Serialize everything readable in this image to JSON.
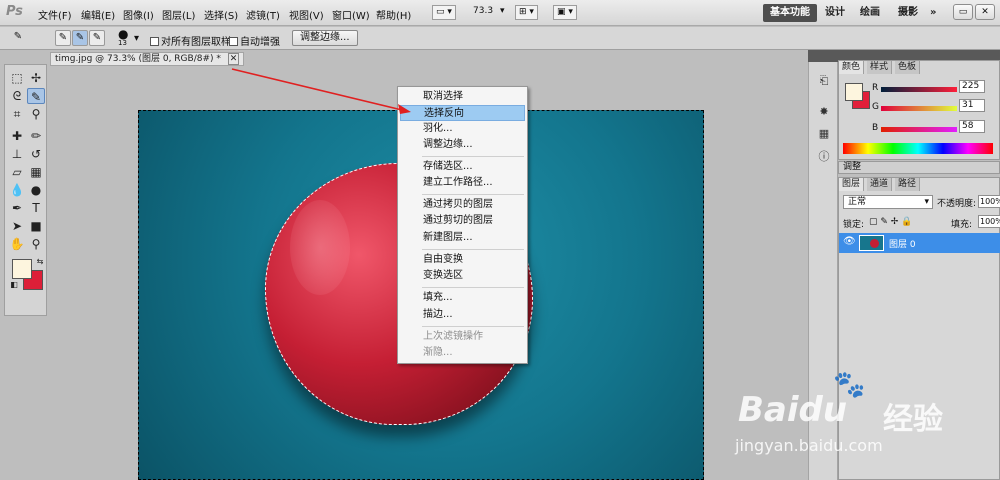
{
  "app": {
    "logo": "Ps"
  },
  "menubar": {
    "items": [
      "文件(F)",
      "编辑(E)",
      "图像(I)",
      "图层(L)",
      "选择(S)",
      "滤镜(T)",
      "视图(V)",
      "窗口(W)",
      "帮助(H)"
    ],
    "zoom": "73.3",
    "workspaces": [
      "基本功能",
      "设计",
      "绘画",
      "摄影"
    ],
    "more": "»"
  },
  "options": {
    "brush_size": "13",
    "sample_all_layers": "对所有图层取样",
    "auto_enhance": "自动增强",
    "refine_edge": "调整边缘..."
  },
  "document": {
    "tab_title": "timg.jpg @ 73.3% (图层 0, RGB/8#) *"
  },
  "context_menu": {
    "items": [
      {
        "label": "取消选择",
        "enabled": true
      },
      {
        "label": "选择反向",
        "enabled": true,
        "highlighted": true
      },
      {
        "label": "羽化...",
        "enabled": true
      },
      {
        "label": "调整边缘...",
        "enabled": true
      },
      {
        "label": "存储选区...",
        "enabled": true
      },
      {
        "label": "建立工作路径...",
        "enabled": true
      },
      {
        "label": "通过拷贝的图层",
        "enabled": true
      },
      {
        "label": "通过剪切的图层",
        "enabled": true
      },
      {
        "label": "新建图层...",
        "enabled": true
      },
      {
        "label": "自由变换",
        "enabled": true
      },
      {
        "label": "变换选区",
        "enabled": true
      },
      {
        "label": "填充...",
        "enabled": true
      },
      {
        "label": "描边...",
        "enabled": true
      },
      {
        "label": "上次滤镜操作",
        "enabled": false
      },
      {
        "label": "渐隐...",
        "enabled": false
      }
    ]
  },
  "color_panel": {
    "tabs": [
      "颜色",
      "样式",
      "色板"
    ],
    "channels": [
      {
        "label": "R",
        "value": "225"
      },
      {
        "label": "G",
        "value": "31"
      },
      {
        "label": "B",
        "value": "58"
      }
    ],
    "fg_hex": "#fdf5de",
    "bg_hex": "#e11f3a"
  },
  "adjustments": {
    "tab": "调整"
  },
  "layers_panel": {
    "tabs": [
      "图层",
      "通道",
      "路径"
    ],
    "blend_mode": "正常",
    "opacity_label": "不透明度:",
    "opacity_value": "100%",
    "lock_label": "锁定:",
    "fill_label": "填充:",
    "fill_value": "100%",
    "layers": [
      {
        "name": "图层 0"
      }
    ]
  },
  "watermark": {
    "brand": "Baidu",
    "brand_cn": "经验",
    "url": "jingyan.baidu.com"
  },
  "colors": {
    "accent_blue": "#3d8ee8",
    "menu_highlight": "#9dcbf2"
  }
}
